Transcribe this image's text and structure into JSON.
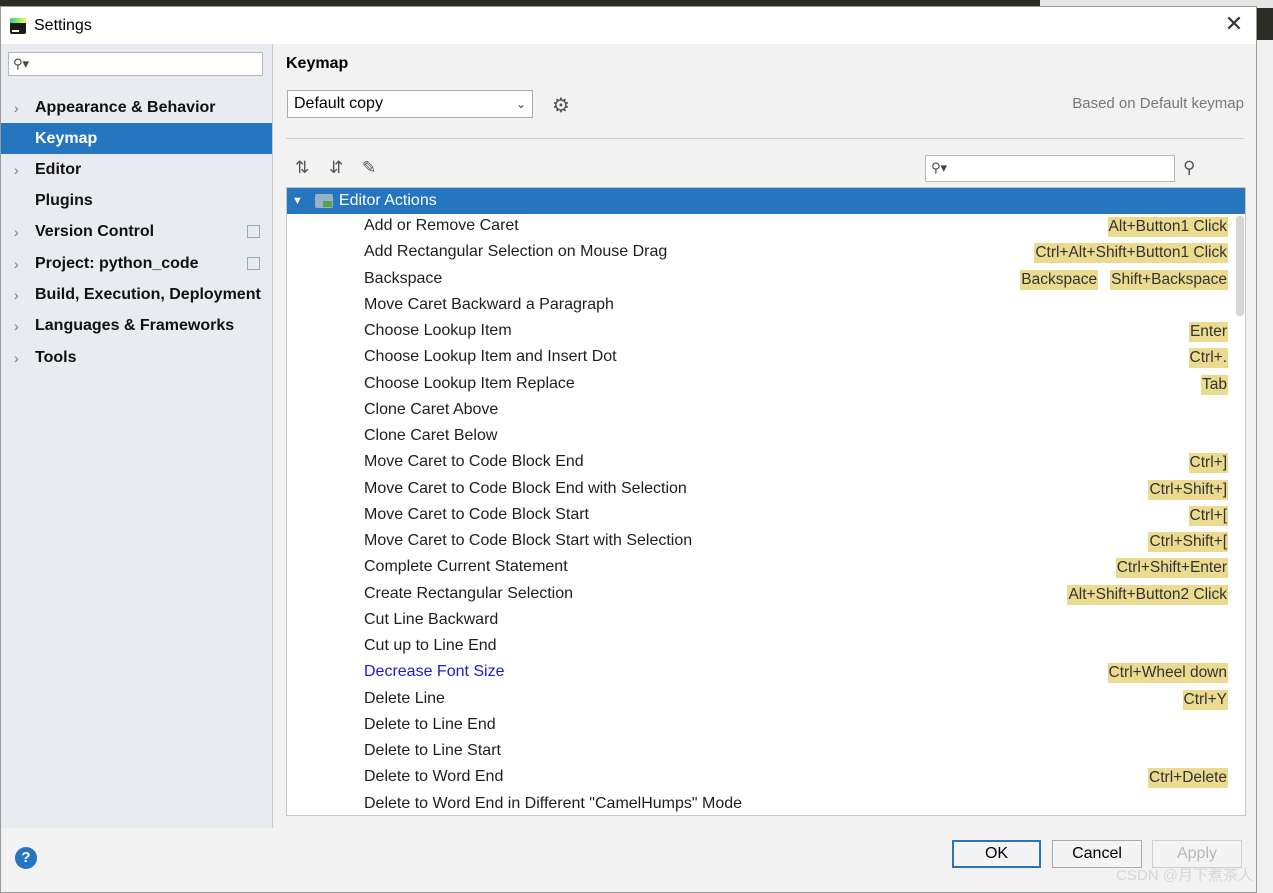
{
  "window": {
    "title": "Settings",
    "close_glyph": "✕"
  },
  "sidebar": {
    "search_placeholder": "",
    "items": [
      {
        "label": "Appearance & Behavior",
        "expandable": true
      },
      {
        "label": "Keymap",
        "expandable": false,
        "selected": true
      },
      {
        "label": "Editor",
        "expandable": true
      },
      {
        "label": "Plugins",
        "expandable": false
      },
      {
        "label": "Version Control",
        "expandable": true,
        "project_icon": true
      },
      {
        "label": "Project: python_code",
        "expandable": true,
        "project_icon": true
      },
      {
        "label": "Build, Execution, Deployment",
        "expandable": true
      },
      {
        "label": "Languages & Frameworks",
        "expandable": true
      },
      {
        "label": "Tools",
        "expandable": true
      }
    ]
  },
  "main": {
    "title": "Keymap",
    "keymap_selected": "Default copy",
    "based_on": "Based on Default keymap",
    "search_placeholder": "",
    "tree": {
      "group_label": "Editor Actions",
      "actions": [
        {
          "label": "Add or Remove Caret",
          "shortcuts": [
            "Alt+Button1 Click"
          ]
        },
        {
          "label": "Add Rectangular Selection on Mouse Drag",
          "shortcuts": [
            "Ctrl+Alt+Shift+Button1 Click"
          ]
        },
        {
          "label": "Backspace",
          "shortcuts": [
            "Backspace",
            "Shift+Backspace"
          ]
        },
        {
          "label": "Move Caret Backward a Paragraph",
          "shortcuts": []
        },
        {
          "label": "Choose Lookup Item",
          "shortcuts": [
            "Enter"
          ]
        },
        {
          "label": "Choose Lookup Item and Insert Dot",
          "shortcuts": [
            "Ctrl+."
          ]
        },
        {
          "label": "Choose Lookup Item Replace",
          "shortcuts": [
            "Tab"
          ]
        },
        {
          "label": "Clone Caret Above",
          "shortcuts": []
        },
        {
          "label": "Clone Caret Below",
          "shortcuts": []
        },
        {
          "label": "Move Caret to Code Block End",
          "shortcuts": [
            "Ctrl+]"
          ]
        },
        {
          "label": "Move Caret to Code Block End with Selection",
          "shortcuts": [
            "Ctrl+Shift+]"
          ]
        },
        {
          "label": "Move Caret to Code Block Start",
          "shortcuts": [
            "Ctrl+["
          ]
        },
        {
          "label": "Move Caret to Code Block Start with Selection",
          "shortcuts": [
            "Ctrl+Shift+["
          ]
        },
        {
          "label": "Complete Current Statement",
          "shortcuts": [
            "Ctrl+Shift+Enter"
          ]
        },
        {
          "label": "Create Rectangular Selection",
          "shortcuts": [
            "Alt+Shift+Button2 Click"
          ]
        },
        {
          "label": "Cut Line Backward",
          "shortcuts": []
        },
        {
          "label": "Cut up to Line End",
          "shortcuts": []
        },
        {
          "label": "Decrease Font Size",
          "shortcuts": [
            "Ctrl+Wheel down"
          ],
          "highlight": true
        },
        {
          "label": "Delete Line",
          "shortcuts": [
            "Ctrl+Y"
          ]
        },
        {
          "label": "Delete to Line End",
          "shortcuts": []
        },
        {
          "label": "Delete to Line Start",
          "shortcuts": []
        },
        {
          "label": "Delete to Word End",
          "shortcuts": [
            "Ctrl+Delete"
          ]
        },
        {
          "label": "Delete to Word End in Different \"CamelHumps\" Mode",
          "shortcuts": []
        }
      ]
    }
  },
  "footer": {
    "help_label": "?",
    "ok_label": "OK",
    "cancel_label": "Cancel",
    "apply_label": "Apply"
  },
  "watermark": "CSDN @月下煮茶人",
  "colors": {
    "selection": "#2675bf",
    "shortcut_bg": "#ebdb90",
    "link_text": "#1a1ad4"
  }
}
